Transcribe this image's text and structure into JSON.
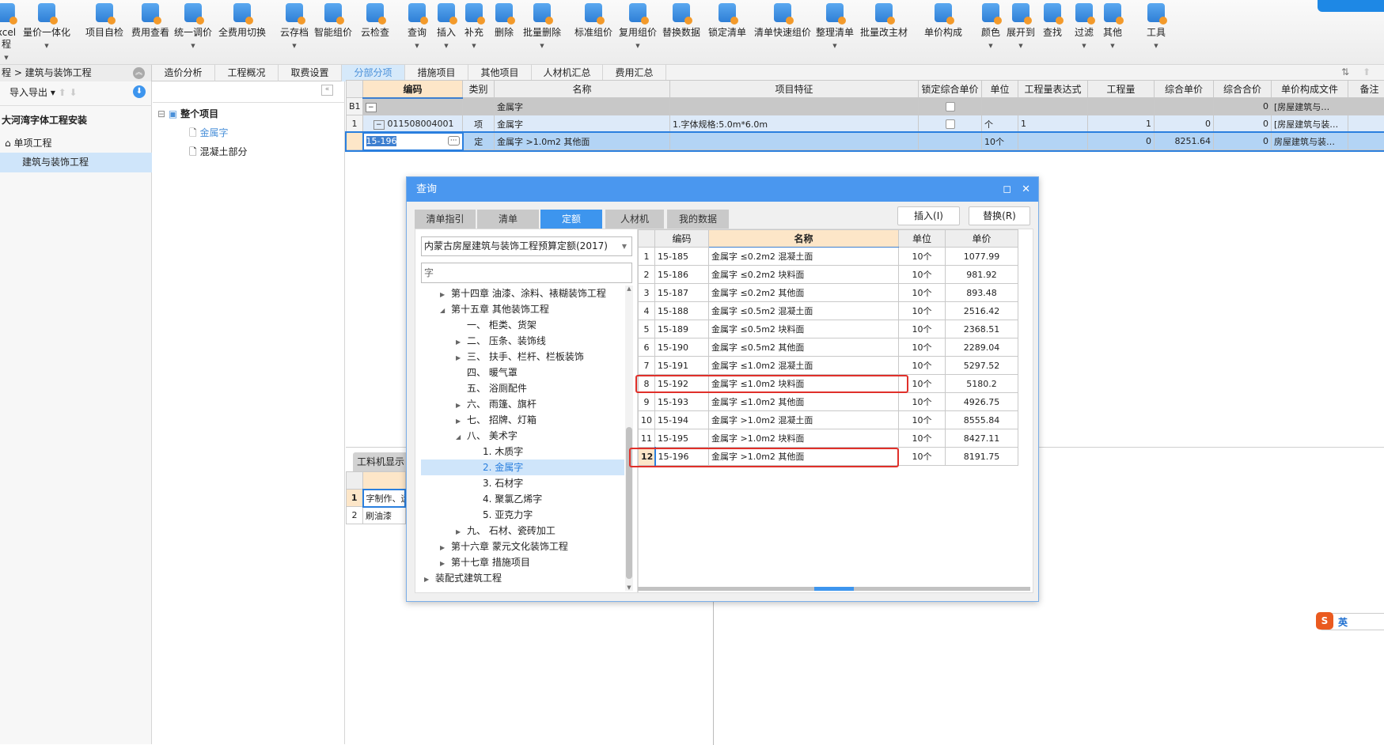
{
  "toolbar": [
    {
      "label": "xcel\n程",
      "arrow": true
    },
    {
      "label": "量价一体化",
      "arrow": true
    },
    {
      "label": "项目自检"
    },
    {
      "label": "费用查看"
    },
    {
      "label": "统一调价",
      "arrow": true
    },
    {
      "label": "全费用切换"
    },
    {
      "label": "云存档",
      "arrow": true
    },
    {
      "label": "智能组价"
    },
    {
      "label": "云检查"
    },
    {
      "label": "查询",
      "arrow": true
    },
    {
      "label": "插入",
      "arrow": true
    },
    {
      "label": "补充",
      "arrow": true
    },
    {
      "label": "删除"
    },
    {
      "label": "批量删除",
      "arrow": true
    },
    {
      "label": "标准组价"
    },
    {
      "label": "复用组价",
      "arrow": true
    },
    {
      "label": "替换数据"
    },
    {
      "label": "锁定清单"
    },
    {
      "label": "清单快速组价"
    },
    {
      "label": "整理清单",
      "arrow": true
    },
    {
      "label": "批量改主材"
    },
    {
      "label": "单价构成"
    },
    {
      "label": "颜色",
      "arrow": true
    },
    {
      "label": "展开到",
      "arrow": true
    },
    {
      "label": "查找"
    },
    {
      "label": "过滤",
      "arrow": true
    },
    {
      "label": "其他",
      "arrow": true
    },
    {
      "label": "工具",
      "arrow": true
    }
  ],
  "main_tabs": [
    "造价分析",
    "工程概况",
    "取费设置",
    "分部分项",
    "措施项目",
    "其他项目",
    "人材机汇总",
    "费用汇总"
  ],
  "main_tab_active": 3,
  "left": {
    "breadcrumb": "程 > 建筑与装饰工程",
    "import_export": "导入导出",
    "tree": [
      "大河湾字体工程安装",
      "单项工程",
      "建筑与装饰工程"
    ]
  },
  "mid": {
    "tree": [
      "整个项目",
      "金属字",
      "混凝土部分"
    ]
  },
  "grid": {
    "columns": [
      "",
      "编码",
      "类别",
      "名称",
      "项目特征",
      "锁定综合单价",
      "单位",
      "工程量表达式",
      "工程量",
      "综合单价",
      "综合合价",
      "单价构成文件",
      "备注"
    ],
    "rows": [
      [
        "B1",
        "",
        "",
        "金属字",
        "",
        "☐",
        "",
        "",
        "",
        "",
        "0",
        "[房屋建筑与…",
        ""
      ],
      [
        "1",
        "011508004001",
        "项",
        "金属字",
        "1.字体规格:5.0m*6.0m",
        "☐",
        "个",
        "1",
        "1",
        "0",
        "0",
        "[房屋建筑与装…",
        ""
      ],
      [
        "",
        "15-196",
        "定",
        "金属字 >1.0m2 其他面",
        "",
        "",
        "10个",
        "",
        "0",
        "8251.64",
        "0",
        "房屋建筑与装…",
        ""
      ]
    ]
  },
  "bottom": {
    "tab": "工料机显示",
    "rows": [
      [
        "1",
        "字制作、运"
      ],
      [
        "2",
        "刷油漆"
      ]
    ]
  },
  "dialog": {
    "title": "查询",
    "tabs": [
      "清单指引",
      "清单",
      "定额",
      "人材机",
      "我的数据"
    ],
    "active_tab": 2,
    "insert_label": "插入(I)",
    "replace_label": "替换(R)",
    "library": "内蒙古房屋建筑与装饰工程预算定额(2017)",
    "search": "字",
    "tree": [
      {
        "t": "第十四章 油漆、涂料、裱糊装饰工程",
        "lvl": 1,
        "exp": "c"
      },
      {
        "t": "第十五章 其他装饰工程",
        "lvl": 1,
        "exp": "o"
      },
      {
        "t": "一、 柜类、货架",
        "lvl": 2
      },
      {
        "t": "二、 压条、装饰线",
        "lvl": 2,
        "exp": "c"
      },
      {
        "t": "三、 扶手、栏杆、栏板装饰",
        "lvl": 2,
        "exp": "c"
      },
      {
        "t": "四、 暖气罩",
        "lvl": 2
      },
      {
        "t": "五、 浴厕配件",
        "lvl": 2
      },
      {
        "t": "六、 雨篷、旗杆",
        "lvl": 2,
        "exp": "c"
      },
      {
        "t": "七、 招牌、灯箱",
        "lvl": 2,
        "exp": "c"
      },
      {
        "t": "八、 美术字",
        "lvl": 2,
        "exp": "o"
      },
      {
        "t": "1. 木质字",
        "lvl": 3
      },
      {
        "t": "2. 金属字",
        "lvl": 3,
        "sel": true
      },
      {
        "t": "3. 石材字",
        "lvl": 3
      },
      {
        "t": "4. 聚氯乙烯字",
        "lvl": 3
      },
      {
        "t": "5. 亚克力字",
        "lvl": 3
      },
      {
        "t": "九、 石材、瓷砖加工",
        "lvl": 2,
        "exp": "c"
      },
      {
        "t": "第十六章 蒙元文化装饰工程",
        "lvl": 1,
        "exp": "c"
      },
      {
        "t": "第十七章 措施项目",
        "lvl": 1,
        "exp": "c"
      },
      {
        "t": "装配式建筑工程",
        "lvl": 0,
        "exp": "c"
      }
    ],
    "columns": [
      "",
      "编码",
      "名称",
      "单位",
      "单价"
    ],
    "rows": [
      [
        "1",
        "15-185",
        "金属字 ≤0.2m2 混凝土面",
        "10个",
        "1077.99"
      ],
      [
        "2",
        "15-186",
        "金属字 ≤0.2m2 块料面",
        "10个",
        "981.92"
      ],
      [
        "3",
        "15-187",
        "金属字 ≤0.2m2 其他面",
        "10个",
        "893.48"
      ],
      [
        "4",
        "15-188",
        "金属字 ≤0.5m2 混凝土面",
        "10个",
        "2516.42"
      ],
      [
        "5",
        "15-189",
        "金属字 ≤0.5m2 块料面",
        "10个",
        "2368.51"
      ],
      [
        "6",
        "15-190",
        "金属字 ≤0.5m2 其他面",
        "10个",
        "2289.04"
      ],
      [
        "7",
        "15-191",
        "金属字 ≤1.0m2 混凝土面",
        "10个",
        "5297.52"
      ],
      [
        "8",
        "15-192",
        "金属字 ≤1.0m2 块料面",
        "10个",
        "5180.2"
      ],
      [
        "9",
        "15-193",
        "金属字 ≤1.0m2 其他面",
        "10个",
        "4926.75"
      ],
      [
        "10",
        "15-194",
        "金属字 >1.0m2 混凝土面",
        "10个",
        "8555.84"
      ],
      [
        "11",
        "15-195",
        "金属字 >1.0m2 块料面",
        "10个",
        "8427.11"
      ],
      [
        "12",
        "15-196",
        "金属字 >1.0m2 其他面",
        "10个",
        "8191.75"
      ]
    ],
    "highlighted_rows": [
      8,
      12
    ]
  },
  "ime": {
    "label": "英"
  },
  "colors": {
    "accent": "#4a97ef",
    "selected_row": "#b3d4f5",
    "header_active": "#fde6c8",
    "highlight": "#e0302a"
  }
}
